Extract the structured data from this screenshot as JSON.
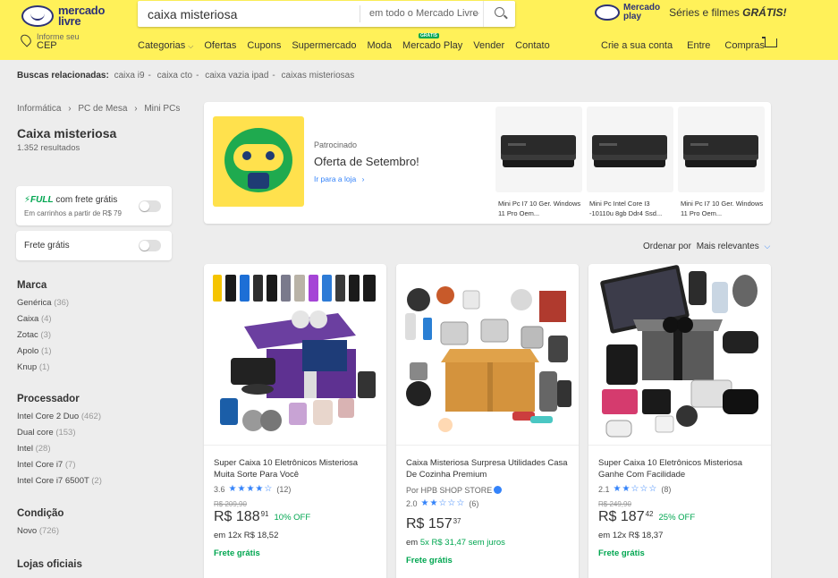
{
  "header": {
    "logo_line1": "mercado",
    "logo_line2": "livre",
    "search_value": "caixa misteriosa",
    "search_scope": "em todo o Mercado Livre",
    "mplay_line1": "Mercado",
    "mplay_line2": "play",
    "mplay_promo_pre": "Séries e filmes",
    "mplay_promo_bold": "GRÁTIS!",
    "location_line1": "Informe seu",
    "location_line2": "CEP",
    "nav": [
      "Categorias",
      "Ofertas",
      "Cupons",
      "Supermercado",
      "Moda",
      "Mercado Play",
      "Vender",
      "Contato"
    ],
    "nav_badge": "GRÁTIS",
    "nav_right": [
      "Crie a sua conta",
      "Entre",
      "Compras"
    ]
  },
  "related": {
    "label": "Buscas relacionadas:",
    "items": [
      "caixa i9",
      "caixa cto",
      "caixa vazia ipad",
      "caixas misteriosas"
    ]
  },
  "breadcrumb": [
    "Informática",
    "PC de Mesa",
    "Mini PCs"
  ],
  "page_title": "Caixa misteriosa",
  "result_count": "1.352 resultados",
  "filters": {
    "full_logo": "FULL",
    "full_text": "com frete grátis",
    "full_sub": "Em carrinhos a partir de R$ 79",
    "free_shipping": "Frete grátis"
  },
  "sections": [
    {
      "title": "Marca",
      "items": [
        [
          "Genérica",
          "(36)"
        ],
        [
          "Caixa",
          "(4)"
        ],
        [
          "Zotac",
          "(3)"
        ],
        [
          "Apolo",
          "(1)"
        ],
        [
          "Knup",
          "(1)"
        ]
      ]
    },
    {
      "title": "Processador",
      "items": [
        [
          "Intel Core 2 Duo",
          "(462)"
        ],
        [
          "Dual core",
          "(153)"
        ],
        [
          "Intel",
          "(28)"
        ],
        [
          "Intel Core i7",
          "(7)"
        ],
        [
          "Intel Core i7 6500T",
          "(2)"
        ]
      ]
    },
    {
      "title": "Condição",
      "items": [
        [
          "Novo",
          "(726)"
        ]
      ]
    },
    {
      "title": "Lojas oficiais",
      "items": []
    }
  ],
  "banner": {
    "sponsored": "Patrocinado",
    "title": "Oferta de Setembro!",
    "link": "Ir para a loja",
    "products": [
      {
        "title": "Mini Pc I7 10 Ger. Windows 11 Pro Oem..."
      },
      {
        "title": "Mini Pc Intel Core I3 -10110u 8gb Ddr4 Ssd..."
      },
      {
        "title": "Mini Pc I7 10 Ger. Windows 11 Pro Oem..."
      }
    ]
  },
  "sort": {
    "label": "Ordenar por",
    "value": "Mais relevantes"
  },
  "products": [
    {
      "title": "Super Caixa 10 Eletrônicos Misteriosa Muita Sorte Para Você",
      "seller": "",
      "rating": "3.6",
      "stars": "★★★★☆",
      "reviews": "(12)",
      "old_price": "R$ 209,90",
      "price": "R$ 188",
      "cents": "91",
      "off": "10% OFF",
      "installments": "em 12x R$ 18,52",
      "installments_free": "",
      "shipping": "Frete grátis"
    },
    {
      "title": "Caixa Misteriosa Surpresa Utilidades Casa De Cozinha Premium",
      "seller": "Por HPB SHOP STORE",
      "rating": "2.0",
      "stars": "★★☆☆☆",
      "reviews": "(6)",
      "old_price": "",
      "price": "R$ 157",
      "cents": "37",
      "off": "",
      "installments": "em",
      "installments_free": "5x R$ 31,47 sem juros",
      "shipping": "Frete grátis"
    },
    {
      "title": "Super Caixa 10 Eletrônicos Misteriosa Ganhe Com Facilidade",
      "seller": "",
      "rating": "2.1",
      "stars": "★★☆☆☆",
      "reviews": "(8)",
      "old_price": "R$ 249,90",
      "price": "R$ 187",
      "cents": "42",
      "off": "25% OFF",
      "installments": "em 12x R$ 18,37",
      "installments_free": "",
      "shipping": "Frete grátis"
    }
  ],
  "colors": {
    "header": "#fff159",
    "accent": "#3483fa",
    "green": "#00a650",
    "brand_navy": "#2d3277"
  }
}
